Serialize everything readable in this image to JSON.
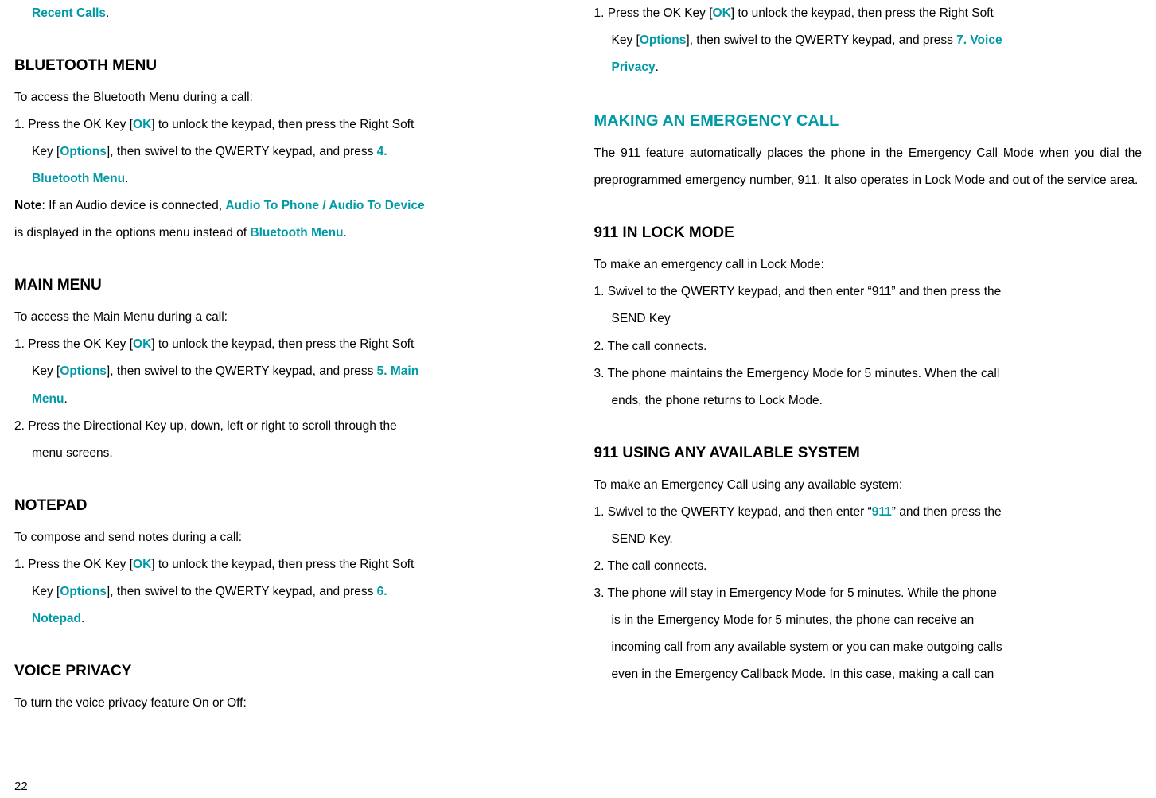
{
  "page_number": "22",
  "left": {
    "recent_calls": "Recent Calls",
    "recent_calls_period": ".",
    "bluetooth_heading": "BLUETOOTH MENU",
    "bluetooth_intro": "To access the Bluetooth Menu during a call:",
    "bl_step1_a": "1.  Press the OK Key [",
    "bl_step1_ok": "OK",
    "bl_step1_b": "] to unlock the keypad, then press the Right Soft",
    "bl_step1_line2_a": "Key [",
    "bl_step1_options": "Options",
    "bl_step1_line2_b": "], then swivel to the QWERTY keypad, and press ",
    "bl_step1_link": "4.",
    "bl_step1_line3_link": "Bluetooth Menu",
    "bl_step1_line3_period": ".",
    "bl_note_label": "Note",
    "bl_note_a": ": If an Audio device is connected, ",
    "bl_note_link": "Audio To Phone / Audio To Device",
    "bl_note_b": "is displayed in the options menu instead of ",
    "bl_note_link2": "Bluetooth Menu",
    "bl_note_period": ".",
    "main_heading": "MAIN MENU",
    "main_intro": "To access the Main Menu during a call:",
    "mm_step1_a": "1.  Press the OK Key [",
    "mm_step1_ok": "OK",
    "mm_step1_b": "] to unlock the keypad, then press the Right Soft",
    "mm_step1_line2_a": "Key [",
    "mm_step1_options": "Options",
    "mm_step1_line2_b": "], then swivel to the QWERTY keypad, and press ",
    "mm_step1_link": "5. Main",
    "mm_step1_line3_link": "Menu",
    "mm_step1_line3_period": ".",
    "mm_step2": "2.  Press the Directional Key up, down, left or right to scroll through the",
    "mm_step2_line2": "menu screens.",
    "notepad_heading": "NOTEPAD",
    "notepad_intro": "To compose and send notes during a call:",
    "np_step1_a": "1.  Press the OK Key [",
    "np_step1_ok": "OK",
    "np_step1_b": "] to unlock the keypad, then press the Right Soft",
    "np_step1_line2_a": "Key [",
    "np_step1_options": "Options",
    "np_step1_line2_b": "], then swivel to the QWERTY keypad, and press ",
    "np_step1_link": "6.",
    "np_step1_line3_link": "Notepad",
    "np_step1_line3_period": ".",
    "vp_heading": "VOICE PRIVACY",
    "vp_intro": "To turn the voice privacy feature On or Off:"
  },
  "right": {
    "vp_step1_a": "1.  Press the OK Key [",
    "vp_step1_ok": "OK",
    "vp_step1_b": "] to unlock the keypad, then press the Right Soft",
    "vp_step1_line2_a": "Key [",
    "vp_step1_options": "Options",
    "vp_step1_line2_b": "], then swivel to the QWERTY keypad, and press ",
    "vp_step1_link": "7. Voice",
    "vp_step1_line3_link": "Privacy",
    "vp_step1_line3_period": ".",
    "emerg_heading": "MAKING AN EMERGENCY CALL",
    "emerg_para": "The 911 feature automatically places the phone in the Emergency Call Mode when you dial the preprogrammed emergency number, 911. It also operates in Lock Mode and out of the service area.",
    "lock_heading": "911 IN LOCK MODE",
    "lock_intro": "To make an emergency call in Lock Mode:",
    "lock_step1": "1.  Swivel to the QWERTY keypad, and then enter “911” and then press the",
    "lock_step1_line2": "SEND Key",
    "lock_step2": "2.  The call connects.",
    "lock_step3": "3.  The phone maintains the Emergency Mode for 5 minutes. When the call",
    "lock_step3_line2": "ends, the phone returns to Lock Mode.",
    "any_heading": "911 USING ANY AVAILABLE SYSTEM",
    "any_intro": "To make an Emergency Call using any available system:",
    "any_step1_a": "1.  Swivel to the QWERTY keypad, and then enter “",
    "any_step1_911": "911",
    "any_step1_b": "” and then press the",
    "any_step1_line2": "SEND Key.",
    "any_step2": "2.  The call connects.",
    "any_step3": "3.  The phone will stay in Emergency Mode for 5 minutes. While the phone",
    "any_step3_line2": "is in the Emergency Mode for 5 minutes, the phone can receive an",
    "any_step3_line3": "incoming call from any available system or you can make outgoing calls",
    "any_step3_line4": "even in the Emergency Callback Mode. In this case, making a call can"
  }
}
